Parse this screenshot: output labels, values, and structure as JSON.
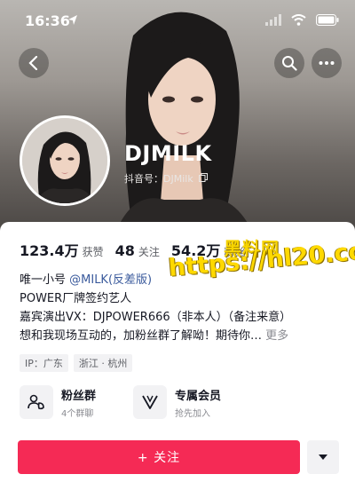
{
  "status_bar": {
    "time": "16:36",
    "icons": [
      "location-arrow-icon",
      "signal-icon",
      "wifi-icon",
      "battery-icon"
    ]
  },
  "header": {
    "back_icon": "back-arrow-icon",
    "search_icon": "search-icon",
    "more_icon": "more-dots-icon"
  },
  "profile": {
    "name": "DJMILK",
    "douyin_id": "抖音号：DJMilk",
    "copy_icon": "copy-icon"
  },
  "stats": [
    {
      "value": "123.4万",
      "label": "获赞"
    },
    {
      "value": "48",
      "label": "关注"
    },
    {
      "value": "54.2万",
      "label": "粉丝"
    }
  ],
  "bio": {
    "line1_prefix": "唯一小号 ",
    "line1_mention": "@MILK(反差版)",
    "line2": "POWER厂牌签约艺人",
    "line3": "嘉宾演出VX：DJPOWER666（非本人）（备注来意）",
    "line4": "想和我现场互动的，加粉丝群了解呦！期待你…",
    "more_label": "更多"
  },
  "tags": [
    "IP：广东",
    "浙江 · 杭州"
  ],
  "features": [
    {
      "icon": "fan-group-icon",
      "title": "粉丝群",
      "subtitle": "4个群聊"
    },
    {
      "icon": "vip-icon",
      "title": "专属会员",
      "subtitle": "抢先加入"
    }
  ],
  "actions": {
    "follow_label": "+ 关注",
    "dropdown_icon": "caret-down-icon"
  },
  "watermark": {
    "text_cn": "黑料网",
    "url": "https://hl20.co"
  },
  "colors": {
    "follow_button": "#f52a55",
    "mention": "#3a5a9c",
    "watermark": "#ffd900"
  }
}
